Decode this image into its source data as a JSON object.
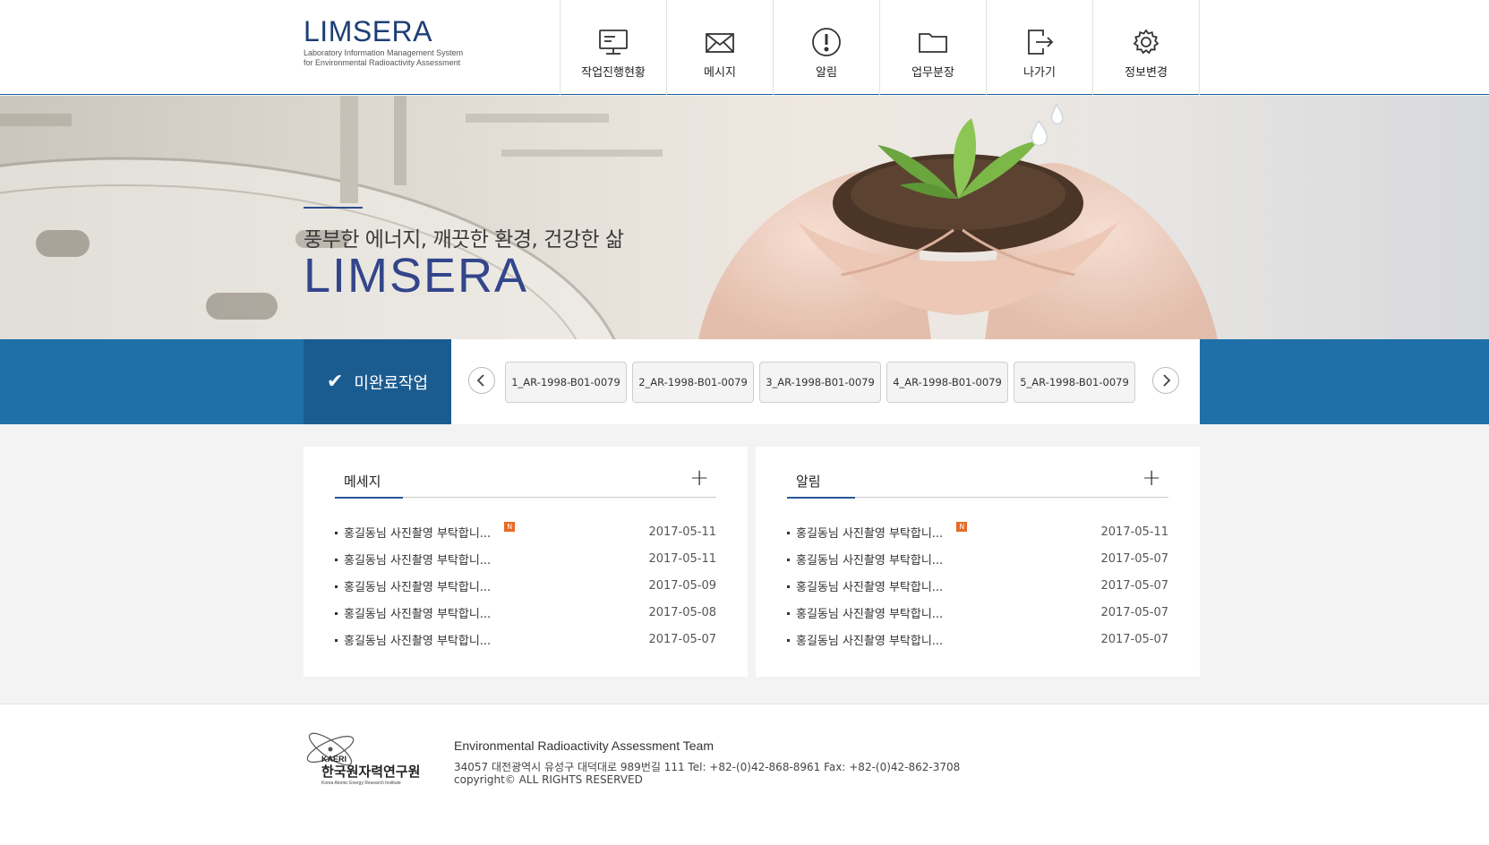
{
  "header": {
    "logo_title": "LIMSERA",
    "logo_sub_1": "Laboratory Information Management System",
    "logo_sub_2": "for Environmental Radioactivity Assessment",
    "nav": [
      {
        "label": "작업진행현황",
        "icon": "monitor-icon"
      },
      {
        "label": "메시지",
        "icon": "envelope-icon"
      },
      {
        "label": "알림",
        "icon": "alert-icon"
      },
      {
        "label": "업무분장",
        "icon": "folder-icon"
      },
      {
        "label": "나가기",
        "icon": "logout-icon"
      },
      {
        "label": "정보변경",
        "icon": "gear-icon"
      }
    ]
  },
  "hero": {
    "subtitle": "풍부한 에너지, 깨끗한 환경, 건강한 삶",
    "title": "LIMSERA"
  },
  "pending": {
    "label": "미완료작업",
    "prev_icon": "chevron-left-icon",
    "next_icon": "chevron-right-icon",
    "items": [
      "1_AR-1998-B01-0079",
      "2_AR-1998-B01-0079",
      "3_AR-1998-B01-0079",
      "4_AR-1998-B01-0079",
      "5_AR-1998-B01-0079"
    ]
  },
  "messages": {
    "title": "메세지",
    "new_badge": "N",
    "items": [
      {
        "text": "홍길동님 사진촬영 부탁합니...",
        "date": "2017-05-11",
        "is_new": true
      },
      {
        "text": "홍길동님 사진촬영 부탁합니...",
        "date": "2017-05-11"
      },
      {
        "text": "홍길동님 사진촬영 부탁합니...",
        "date": "2017-05-09"
      },
      {
        "text": "홍길동님 사진촬영 부탁합니...",
        "date": "2017-05-08"
      },
      {
        "text": "홍길동님 사진촬영 부탁합니...",
        "date": "2017-05-07"
      }
    ]
  },
  "alerts": {
    "title": "알림",
    "new_badge": "N",
    "items": [
      {
        "text": "홍길동님 사진촬영 부탁합니...",
        "date": "2017-05-11",
        "is_new": true
      },
      {
        "text": "홍길동님 사진촬영 부탁합니...",
        "date": "2017-05-07"
      },
      {
        "text": "홍길동님 사진촬영 부탁합니...",
        "date": "2017-05-07"
      },
      {
        "text": "홍길동님 사진촬영 부탁합니...",
        "date": "2017-05-07"
      },
      {
        "text": "홍길동님 사진촬영 부탁합니...",
        "date": "2017-05-07"
      }
    ]
  },
  "footer": {
    "org_short": "KAERI",
    "org_korean": "한국원자력연구원",
    "org_english": "Korea Atomic Energy Research Institute",
    "team": "Environmental Radioactivity Assessment Team",
    "address": "34057 대전광역시 유성구 대덕대로 989번길 111 Tel: +82-(0)42-868-8961 Fax: +82-(0)42-862-3708",
    "copyright": "copyright© ALL RIGHTS RESERVED"
  },
  "colors": {
    "brand_navy": "#1d3f74",
    "hero_title": "#33458b",
    "bar_blue": "#1f70a8",
    "label_blue": "#1b5c90",
    "new_badge": "#e86a24"
  }
}
